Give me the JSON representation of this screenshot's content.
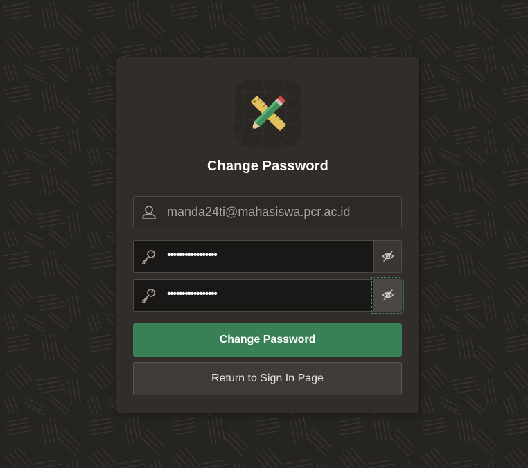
{
  "page": {
    "title": "Change Password",
    "app_icon": "pencil-ruler-icon"
  },
  "form": {
    "username": {
      "value": "manda24ti@mahasiswa.pcr.ac.id",
      "icon": "user-icon"
    },
    "new_password": {
      "masked_value": "•••••••••••••••••",
      "icon": "key-icon",
      "toggle_icon": "eye-slash-icon"
    },
    "confirm_password": {
      "masked_value": "•••••••••••••••••",
      "icon": "key-icon",
      "toggle_icon": "eye-slash-icon"
    }
  },
  "buttons": {
    "change_password_label": "Change Password",
    "return_label": "Return to Sign In Page"
  },
  "colors": {
    "background": "#262421",
    "card": "#312d2a",
    "primary_button": "#3a8057",
    "secondary_button": "#3f3b37",
    "input_dark": "#1a1816",
    "focus_outline": "#3fa26a"
  }
}
